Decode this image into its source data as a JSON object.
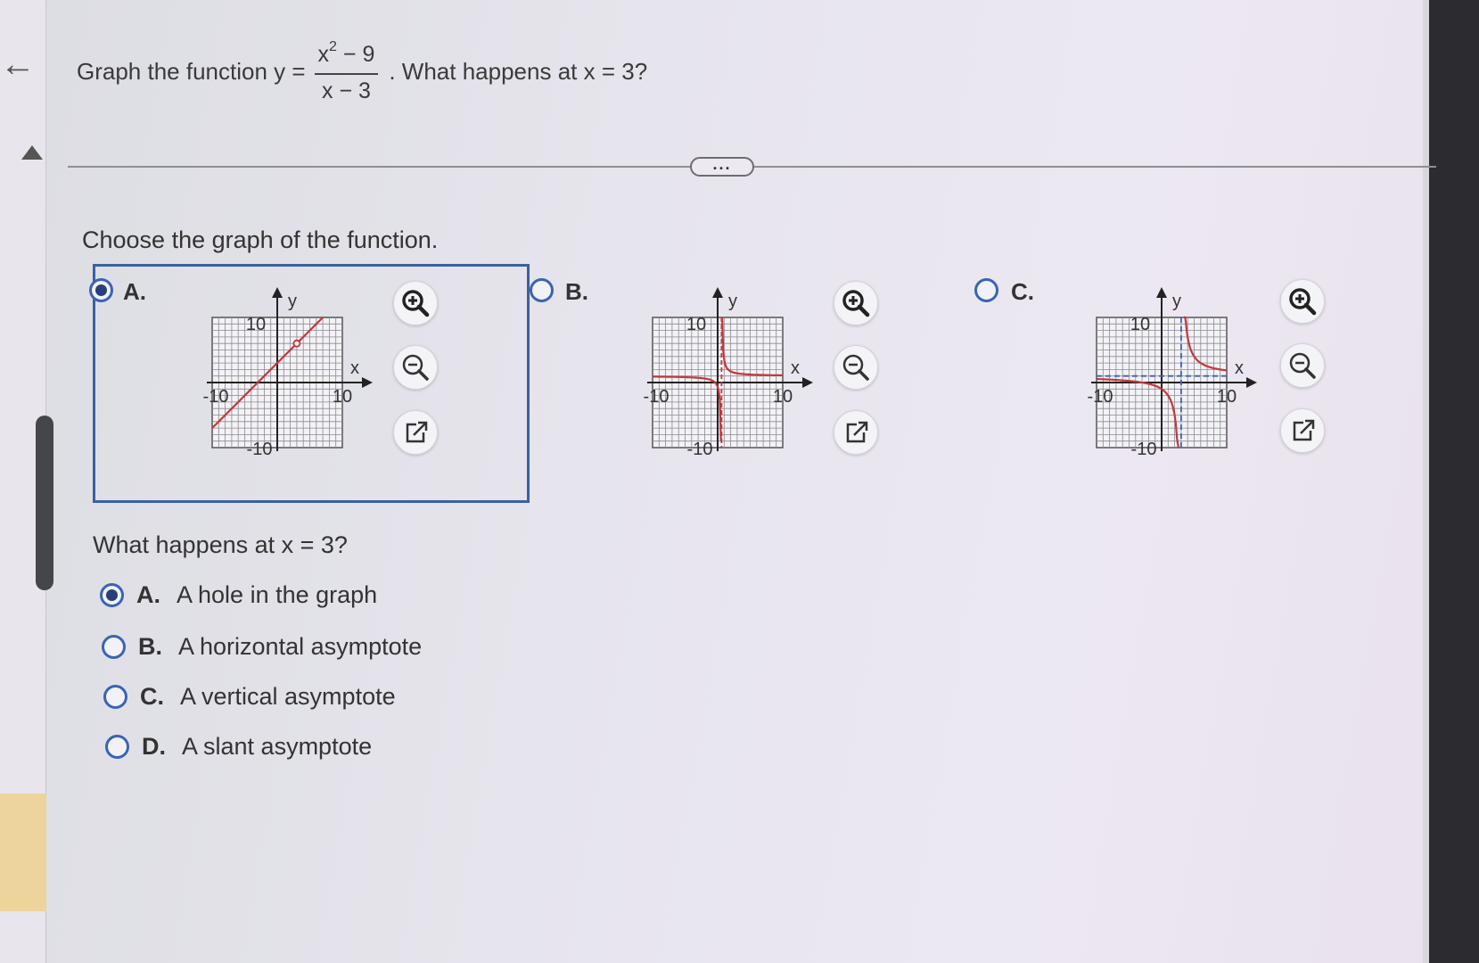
{
  "question": {
    "prefix": "Graph the function y =",
    "numerator_base": "x",
    "numerator_exp": "2",
    "numerator_rest": "− 9",
    "denominator": "x − 3",
    "suffix": ". What happens at x = 3?"
  },
  "prompt": "Choose the graph of the function.",
  "graph_options": [
    {
      "letter": "A.",
      "selected": true,
      "axis_x": "x",
      "axis_y": "y",
      "tick_pos": "10",
      "tick_neg": "-10",
      "tick_y_pos": "10",
      "tick_y_neg": "-10"
    },
    {
      "letter": "B.",
      "selected": false,
      "axis_x": "x",
      "axis_y": "y",
      "tick_pos": "10",
      "tick_neg": "-10",
      "tick_y_pos": "10",
      "tick_y_neg": "-10"
    },
    {
      "letter": "C.",
      "selected": false,
      "axis_x": "x",
      "axis_y": "y",
      "tick_pos": "10",
      "tick_neg": "-10",
      "tick_y_pos": "10",
      "tick_y_neg": "-10"
    }
  ],
  "tools": {
    "zoom_in": "zoom-in-icon",
    "zoom_out": "zoom-out-icon",
    "popout": "external-link-icon"
  },
  "question2": "What happens at x = 3?",
  "answers": [
    {
      "letter": "A.",
      "text": "A hole in the graph",
      "selected": true
    },
    {
      "letter": "B.",
      "text": "A horizontal asymptote",
      "selected": false
    },
    {
      "letter": "C.",
      "text": "A vertical asymptote",
      "selected": false
    },
    {
      "letter": "D.",
      "text": "A slant asymptote",
      "selected": false
    }
  ],
  "colors": {
    "curve": "#c0393b",
    "grid": "#8a8a90",
    "accent": "#3b63b3",
    "selected_dot": "#2a3f78"
  }
}
